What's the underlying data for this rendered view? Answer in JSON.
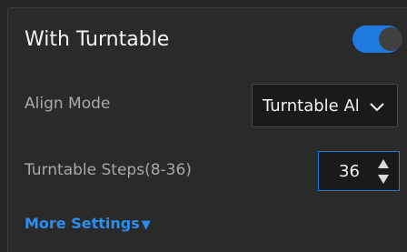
{
  "title": "With Turntable",
  "toggle": {
    "state": "on",
    "color": "#1f7ae0"
  },
  "align_mode": {
    "label": "Align Mode",
    "selected": "Turntable Alignment"
  },
  "steps": {
    "label": "Turntable Steps(8-36)",
    "value": "36"
  },
  "more": {
    "label": "More Settings",
    "arrow": "▼"
  },
  "colors": {
    "accent": "#1f7ae0",
    "link": "#2a8ef0",
    "background": "#2a2a2a"
  }
}
